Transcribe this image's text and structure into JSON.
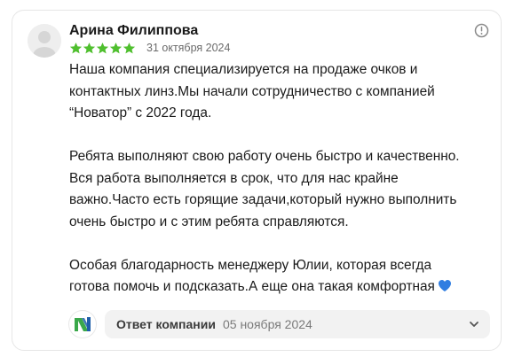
{
  "review": {
    "author": "Арина Филиппова",
    "rating": 5,
    "date": "31 октября 2024",
    "paragraphs": [
      [
        "Наша компания специализируется на продаже очков и",
        "контактных линз.Мы начали сотрудничество с компанией",
        "“Новатор” с 2022 года."
      ],
      [
        "Ребята выполняют свою работу очень быстро и качественно.",
        "Вся работа выполняется в срок, что для нас крайне",
        "важно.Часто есть горящие задачи,который нужно выполнить",
        "очень быстро и с этим ребята справляются."
      ],
      [
        "Особая благодарность менеджеру Юлии, которая всегда",
        "готова помочь и подсказать.А еще она такая комфортная"
      ]
    ]
  },
  "reply": {
    "label": "Ответ компании",
    "date": "05 ноября 2024"
  },
  "colors": {
    "star": "#4fbf2e",
    "heart": "#2f7de1",
    "logo_green": "#3aa84a",
    "logo_blue": "#1f5fa8"
  },
  "icons": {
    "info": "info-circle-icon",
    "chevron": "chevron-down-icon",
    "heart": "blue-heart-icon",
    "company_logo": "novator-logo-icon",
    "avatar": "default-avatar-icon"
  }
}
